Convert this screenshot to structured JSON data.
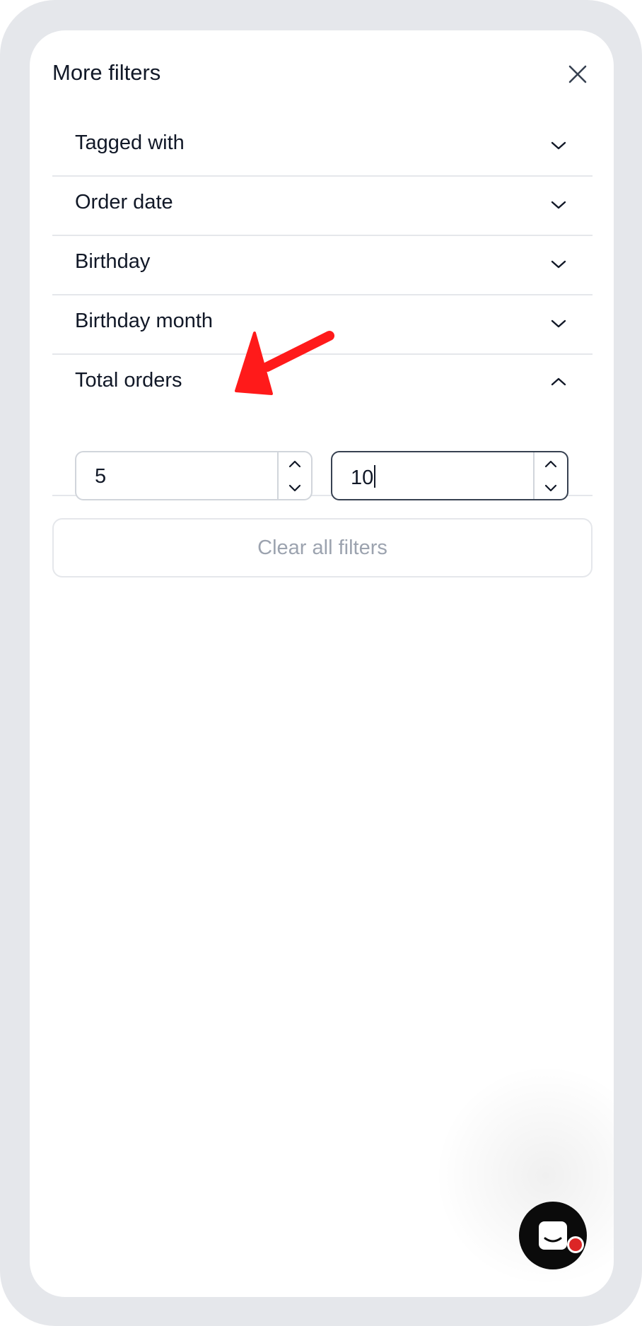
{
  "panel": {
    "title": "More filters"
  },
  "filters": [
    {
      "label": "Tagged with",
      "expanded": false
    },
    {
      "label": "Order date",
      "expanded": false
    },
    {
      "label": "Birthday",
      "expanded": false
    },
    {
      "label": "Birthday month",
      "expanded": false
    }
  ],
  "total_orders": {
    "label": "Total orders",
    "expanded": true,
    "min_value": "5",
    "max_value": "10"
  },
  "clear_button": {
    "label": "Clear all filters"
  },
  "icons": {
    "close": "close-icon",
    "collapse": "chevron-up-icon",
    "expand": "chevron-down-icon",
    "chat": "chat-icon",
    "annotation": "red-arrow-annotation"
  },
  "colors": {
    "frame": "#e5e7eb",
    "annotation_arrow": "#ff1a1a",
    "notification_dot": "#dc2626",
    "muted_text": "#9ca3af"
  }
}
